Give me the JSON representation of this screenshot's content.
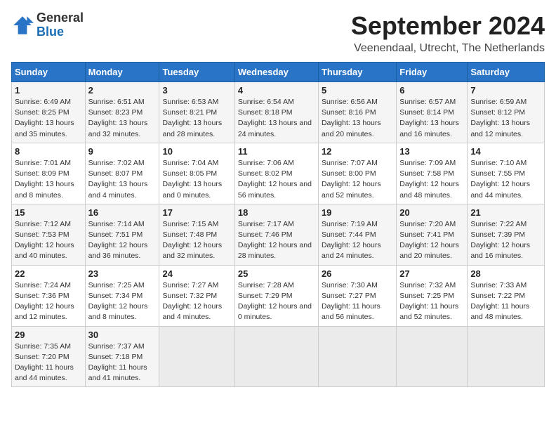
{
  "header": {
    "logo_general": "General",
    "logo_blue": "Blue",
    "month_title": "September 2024",
    "location": "Veenendaal, Utrecht, The Netherlands"
  },
  "days_of_week": [
    "Sunday",
    "Monday",
    "Tuesday",
    "Wednesday",
    "Thursday",
    "Friday",
    "Saturday"
  ],
  "weeks": [
    [
      {
        "day": "1",
        "sunrise": "6:49 AM",
        "sunset": "8:25 PM",
        "daylight": "13 hours and 35 minutes."
      },
      {
        "day": "2",
        "sunrise": "6:51 AM",
        "sunset": "8:23 PM",
        "daylight": "13 hours and 32 minutes."
      },
      {
        "day": "3",
        "sunrise": "6:53 AM",
        "sunset": "8:21 PM",
        "daylight": "13 hours and 28 minutes."
      },
      {
        "day": "4",
        "sunrise": "6:54 AM",
        "sunset": "8:18 PM",
        "daylight": "13 hours and 24 minutes."
      },
      {
        "day": "5",
        "sunrise": "6:56 AM",
        "sunset": "8:16 PM",
        "daylight": "13 hours and 20 minutes."
      },
      {
        "day": "6",
        "sunrise": "6:57 AM",
        "sunset": "8:14 PM",
        "daylight": "13 hours and 16 minutes."
      },
      {
        "day": "7",
        "sunrise": "6:59 AM",
        "sunset": "8:12 PM",
        "daylight": "13 hours and 12 minutes."
      }
    ],
    [
      {
        "day": "8",
        "sunrise": "7:01 AM",
        "sunset": "8:09 PM",
        "daylight": "13 hours and 8 minutes."
      },
      {
        "day": "9",
        "sunrise": "7:02 AM",
        "sunset": "8:07 PM",
        "daylight": "13 hours and 4 minutes."
      },
      {
        "day": "10",
        "sunrise": "7:04 AM",
        "sunset": "8:05 PM",
        "daylight": "13 hours and 0 minutes."
      },
      {
        "day": "11",
        "sunrise": "7:06 AM",
        "sunset": "8:02 PM",
        "daylight": "12 hours and 56 minutes."
      },
      {
        "day": "12",
        "sunrise": "7:07 AM",
        "sunset": "8:00 PM",
        "daylight": "12 hours and 52 minutes."
      },
      {
        "day": "13",
        "sunrise": "7:09 AM",
        "sunset": "7:58 PM",
        "daylight": "12 hours and 48 minutes."
      },
      {
        "day": "14",
        "sunrise": "7:10 AM",
        "sunset": "7:55 PM",
        "daylight": "12 hours and 44 minutes."
      }
    ],
    [
      {
        "day": "15",
        "sunrise": "7:12 AM",
        "sunset": "7:53 PM",
        "daylight": "12 hours and 40 minutes."
      },
      {
        "day": "16",
        "sunrise": "7:14 AM",
        "sunset": "7:51 PM",
        "daylight": "12 hours and 36 minutes."
      },
      {
        "day": "17",
        "sunrise": "7:15 AM",
        "sunset": "7:48 PM",
        "daylight": "12 hours and 32 minutes."
      },
      {
        "day": "18",
        "sunrise": "7:17 AM",
        "sunset": "7:46 PM",
        "daylight": "12 hours and 28 minutes."
      },
      {
        "day": "19",
        "sunrise": "7:19 AM",
        "sunset": "7:44 PM",
        "daylight": "12 hours and 24 minutes."
      },
      {
        "day": "20",
        "sunrise": "7:20 AM",
        "sunset": "7:41 PM",
        "daylight": "12 hours and 20 minutes."
      },
      {
        "day": "21",
        "sunrise": "7:22 AM",
        "sunset": "7:39 PM",
        "daylight": "12 hours and 16 minutes."
      }
    ],
    [
      {
        "day": "22",
        "sunrise": "7:24 AM",
        "sunset": "7:36 PM",
        "daylight": "12 hours and 12 minutes."
      },
      {
        "day": "23",
        "sunrise": "7:25 AM",
        "sunset": "7:34 PM",
        "daylight": "12 hours and 8 minutes."
      },
      {
        "day": "24",
        "sunrise": "7:27 AM",
        "sunset": "7:32 PM",
        "daylight": "12 hours and 4 minutes."
      },
      {
        "day": "25",
        "sunrise": "7:28 AM",
        "sunset": "7:29 PM",
        "daylight": "12 hours and 0 minutes."
      },
      {
        "day": "26",
        "sunrise": "7:30 AM",
        "sunset": "7:27 PM",
        "daylight": "11 hours and 56 minutes."
      },
      {
        "day": "27",
        "sunrise": "7:32 AM",
        "sunset": "7:25 PM",
        "daylight": "11 hours and 52 minutes."
      },
      {
        "day": "28",
        "sunrise": "7:33 AM",
        "sunset": "7:22 PM",
        "daylight": "11 hours and 48 minutes."
      }
    ],
    [
      {
        "day": "29",
        "sunrise": "7:35 AM",
        "sunset": "7:20 PM",
        "daylight": "11 hours and 44 minutes."
      },
      {
        "day": "30",
        "sunrise": "7:37 AM",
        "sunset": "7:18 PM",
        "daylight": "11 hours and 41 minutes."
      },
      null,
      null,
      null,
      null,
      null
    ]
  ]
}
